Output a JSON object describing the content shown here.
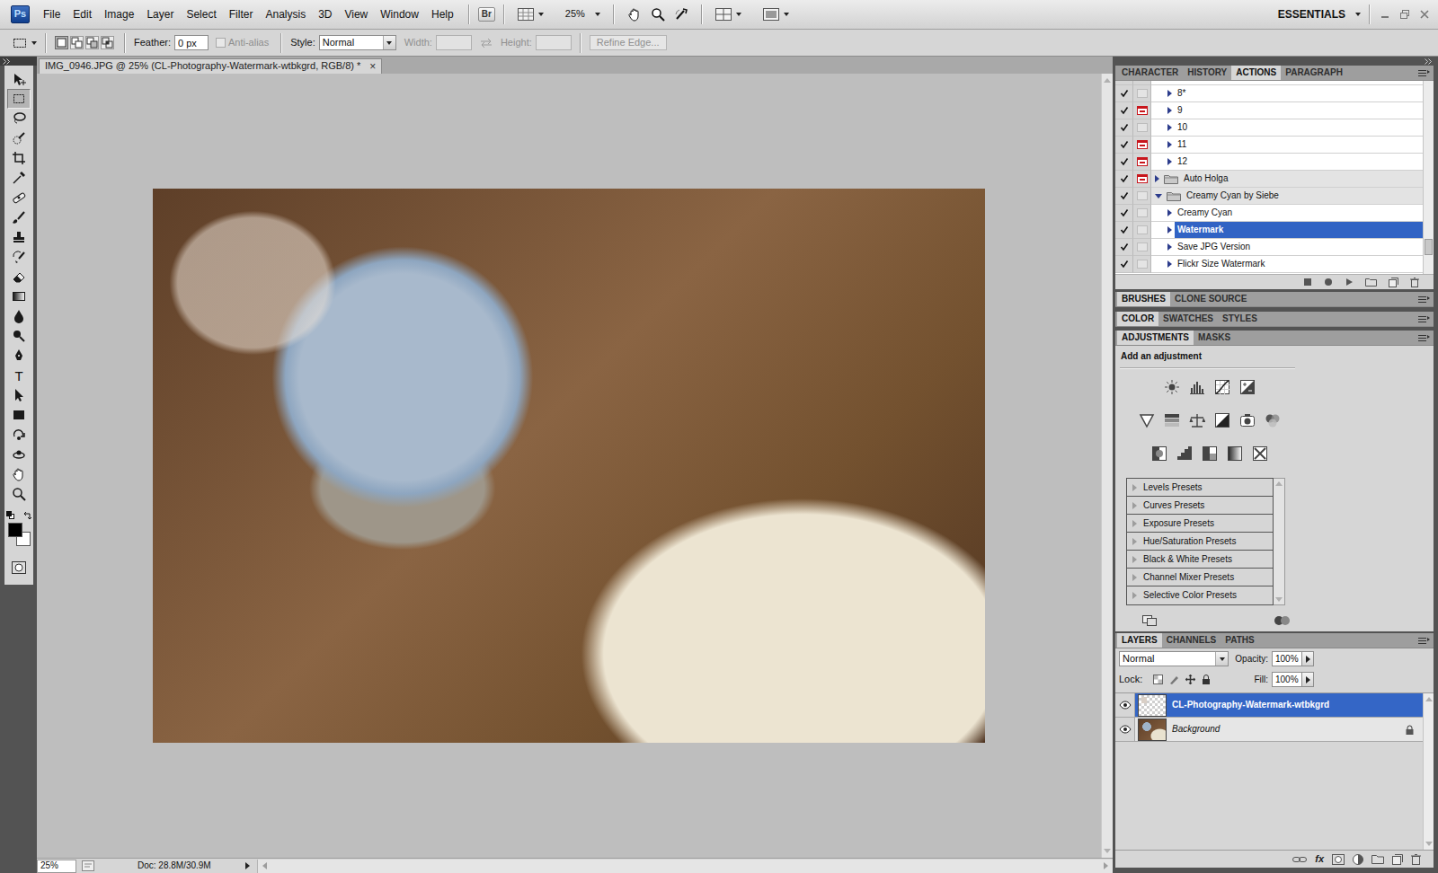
{
  "app_bar": {
    "logo": "Ps",
    "menus": [
      "File",
      "Edit",
      "Image",
      "Layer",
      "Select",
      "Filter",
      "Analysis",
      "3D",
      "View",
      "Window",
      "Help"
    ],
    "bridge": "Br",
    "zoom": "25%",
    "workspace": "ESSENTIALS"
  },
  "options_bar": {
    "selection_modes": [
      {
        "selected": true
      },
      {
        "selected": false
      },
      {
        "selected": false
      },
      {
        "selected": false
      }
    ],
    "feather_label": "Feather:",
    "feather": "0 px",
    "anti_alias": {
      "label": "Anti-alias",
      "checked": false,
      "disabled": true
    },
    "style_label": "Style:",
    "style": "Normal",
    "width": {
      "label": "Width:",
      "disabled": true
    },
    "height": {
      "label": "Height:",
      "disabled": true
    },
    "refine_edge": {
      "label": "Refine Edge...",
      "disabled": true
    }
  },
  "tools": [
    {
      "selected": false
    },
    {
      "selected": true
    },
    {
      "selected": false
    },
    {
      "selected": false
    },
    {
      "selected": false
    },
    {
      "selected": false
    },
    {
      "selected": false
    },
    {
      "selected": false
    },
    {
      "selected": false
    },
    {
      "selected": false
    },
    {
      "selected": false
    },
    {
      "selected": false
    },
    {
      "selected": false
    },
    {
      "selected": false
    },
    {
      "selected": false
    },
    {
      "label": "T",
      "selected": false
    },
    {
      "selected": false
    },
    {
      "selected": false
    },
    {
      "selected": false
    },
    {
      "selected": false
    },
    {
      "selected": false
    },
    {
      "selected": false
    }
  ],
  "colors": {
    "foreground": "#000000",
    "background": "#ffffff"
  },
  "document": {
    "tab": "IMG_0946.JPG @ 25% (CL-Photography-Watermark-wtbkgrd, RGB/8) *",
    "close": "×",
    "zoom": "25%",
    "doc_size": "Doc: 28.8M/30.9M"
  },
  "actions_panel": {
    "tabs": [
      {
        "label": "CHARACTER",
        "selected": false
      },
      {
        "label": "HISTORY",
        "selected": false
      },
      {
        "label": "ACTIONS",
        "selected": true
      },
      {
        "label": "PARAGRAPH",
        "selected": false
      }
    ],
    "items": [
      {
        "name": "8*",
        "kind": "action",
        "checked": true,
        "dialog": false,
        "expanded": false,
        "selected": false
      },
      {
        "name": "9",
        "kind": "action",
        "checked": true,
        "dialog": true,
        "expanded": false,
        "selected": false
      },
      {
        "name": "10",
        "kind": "action",
        "checked": true,
        "dialog": false,
        "expanded": false,
        "selected": false
      },
      {
        "name": "11",
        "kind": "action",
        "checked": true,
        "dialog": true,
        "expanded": false,
        "selected": false
      },
      {
        "name": "12",
        "kind": "action",
        "checked": true,
        "dialog": true,
        "expanded": false,
        "selected": false
      },
      {
        "name": "Auto Holga",
        "kind": "set",
        "checked": true,
        "dialog": true,
        "expanded": false,
        "selected": false
      },
      {
        "name": "Creamy Cyan by Siebe",
        "kind": "set",
        "checked": true,
        "dialog": false,
        "expanded": true,
        "selected": false
      },
      {
        "name": "Creamy Cyan",
        "kind": "action",
        "checked": true,
        "dialog": false,
        "expanded": false,
        "selected": false
      },
      {
        "name": "Watermark",
        "kind": "action",
        "checked": true,
        "dialog": false,
        "expanded": false,
        "selected": true
      },
      {
        "name": "Save JPG Version",
        "kind": "action",
        "checked": true,
        "dialog": false,
        "expanded": false,
        "selected": false
      },
      {
        "name": "Flickr Size Watermark",
        "kind": "action",
        "checked": true,
        "dialog": false,
        "expanded": false,
        "selected": false
      }
    ],
    "scroll": 0.9
  },
  "brushes_group": {
    "tabs": [
      {
        "label": "BRUSHES",
        "selected": true
      },
      {
        "label": "CLONE SOURCE",
        "selected": false
      }
    ]
  },
  "color_group": {
    "tabs": [
      {
        "label": "COLOR",
        "selected": true
      },
      {
        "label": "SWATCHES",
        "selected": false
      },
      {
        "label": "STYLES",
        "selected": false
      }
    ]
  },
  "adjustments_panel": {
    "tabs": [
      {
        "label": "ADJUSTMENTS",
        "selected": true
      },
      {
        "label": "MASKS",
        "selected": false
      }
    ],
    "title": "Add an adjustment",
    "presets": [
      {
        "label": "Levels Presets",
        "expanded": false
      },
      {
        "label": "Curves Presets",
        "expanded": false
      },
      {
        "label": "Exposure Presets",
        "expanded": false
      },
      {
        "label": "Hue/Saturation Presets",
        "expanded": false
      },
      {
        "label": "Black & White Presets",
        "expanded": false
      },
      {
        "label": "Channel Mixer Presets",
        "expanded": false
      },
      {
        "label": "Selective Color Presets",
        "expanded": false
      }
    ]
  },
  "layers_panel": {
    "tabs": [
      {
        "label": "LAYERS",
        "selected": true
      },
      {
        "label": "CHANNELS",
        "selected": false
      },
      {
        "label": "PATHS",
        "selected": false
      }
    ],
    "blend_mode": "Normal",
    "opacity_label": "Opacity:",
    "opacity": "100%",
    "lock_label": "Lock:",
    "fill_label": "Fill:",
    "fill": "100%",
    "layers": [
      {
        "name": "CL-Photography-Watermark-wtbkgrd",
        "kind": "layer",
        "visible": true,
        "selected": true,
        "locked": false
      },
      {
        "name": "Background",
        "kind": "background",
        "visible": true,
        "selected": false,
        "locked": true
      }
    ],
    "fx": "fx"
  }
}
